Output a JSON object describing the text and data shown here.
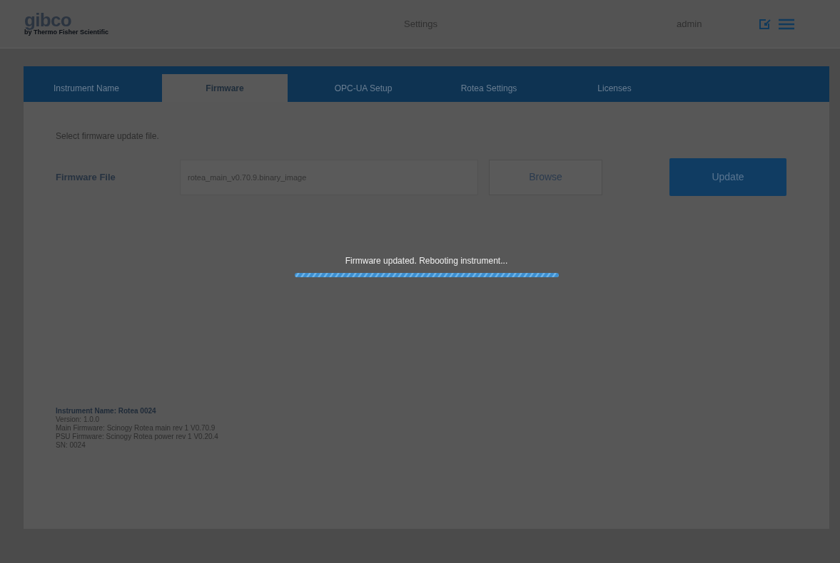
{
  "header": {
    "logo": "gibco",
    "logo_tagline": "by Thermo Fisher Scientific",
    "title": "Settings",
    "user": "admin"
  },
  "tabs": [
    {
      "label": "Instrument Name",
      "selected": false
    },
    {
      "label": "Firmware",
      "selected": true
    },
    {
      "label": "OPC-UA Setup",
      "selected": false
    },
    {
      "label": "Rotea Settings",
      "selected": false
    },
    {
      "label": "Licenses",
      "selected": false
    }
  ],
  "firmware": {
    "instruction": "Select firmware update file.",
    "label": "Firmware File",
    "value": "rotea_main_v0.70.9.binary_image",
    "browse_button": "Browse",
    "update_button": "Update"
  },
  "progress": {
    "message": "Firmware updated. Rebooting instrument...",
    "level": 1
  },
  "info": [
    {
      "text": "Instrument Name: Rotea 0024",
      "bold": true
    },
    {
      "text": "Version: 1.0.0",
      "bold": false
    },
    {
      "text": "Main Firmware: Scinogy Rotea main rev 1 V0.70.9",
      "bold": false
    },
    {
      "text": "PSU Firmware: Scinogy Rotea power rev 1 V0.20.4",
      "bold": false
    },
    {
      "text": "SN: 0024",
      "bold": false
    }
  ]
}
